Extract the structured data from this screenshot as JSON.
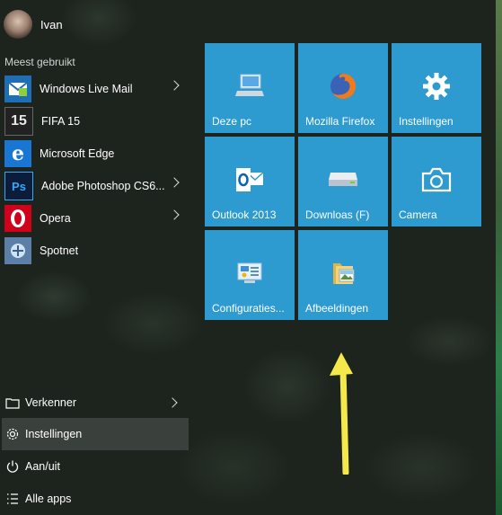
{
  "user": {
    "name": "Ivan"
  },
  "section_title": "Meest gebruikt",
  "apps": [
    {
      "label": "Windows Live Mail",
      "icon": "mail-icon",
      "has_submenu": true
    },
    {
      "label": "FIFA 15",
      "icon": "fifa-icon",
      "has_submenu": false
    },
    {
      "label": "Microsoft Edge",
      "icon": "edge-icon",
      "has_submenu": false
    },
    {
      "label": "Adobe Photoshop CS6...",
      "icon": "photoshop-icon",
      "has_submenu": true
    },
    {
      "label": "Opera",
      "icon": "opera-icon",
      "has_submenu": true
    },
    {
      "label": "Spotnet",
      "icon": "spotnet-icon",
      "has_submenu": false
    }
  ],
  "bottom_items": [
    {
      "label": "Verkenner",
      "icon": "folder-icon",
      "has_submenu": true
    },
    {
      "label": "Instellingen",
      "icon": "gear-icon",
      "active": true
    },
    {
      "label": "Aan/uit",
      "icon": "power-icon"
    },
    {
      "label": "Alle apps",
      "icon": "list-icon"
    }
  ],
  "tiles": [
    {
      "label": "Deze pc",
      "icon": "computer-icon"
    },
    {
      "label": "Mozilla Firefox",
      "icon": "firefox-icon"
    },
    {
      "label": "Instellingen",
      "icon": "gear-icon"
    },
    {
      "label": "Outlook 2013",
      "icon": "outlook-icon"
    },
    {
      "label": "Downloas (F)",
      "icon": "drive-icon"
    },
    {
      "label": "Camera",
      "icon": "camera-icon"
    },
    {
      "label": "Configuraties...",
      "icon": "control-panel-icon"
    },
    {
      "label": "Afbeeldingen",
      "icon": "pictures-folder-icon"
    }
  ],
  "colors": {
    "tile": "#2d9ad0",
    "arrow": "#f5e84a"
  }
}
